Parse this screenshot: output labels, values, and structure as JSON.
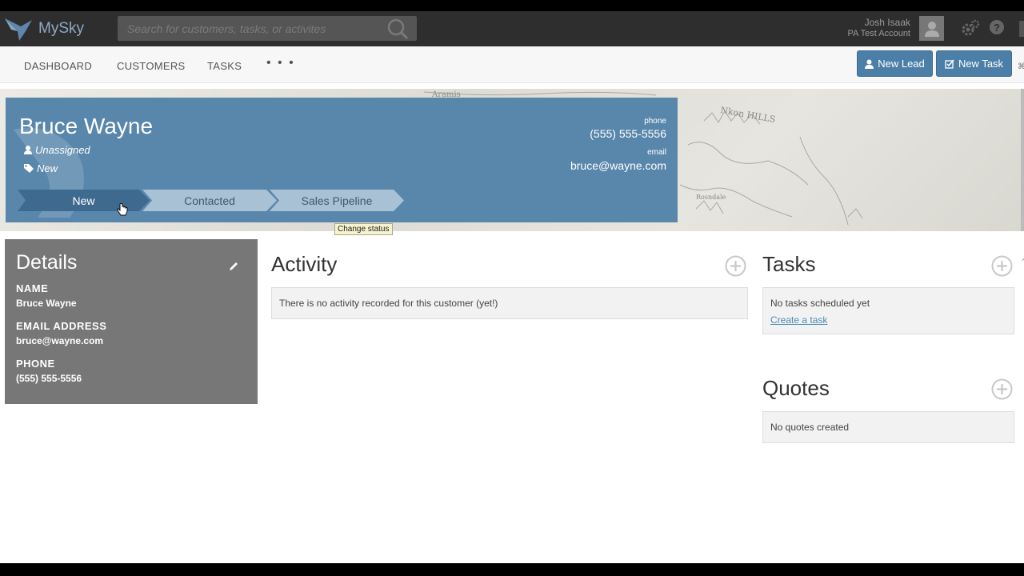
{
  "app": {
    "name": "MySky",
    "search_placeholder": "Search for customers, tasks, or activites",
    "user_name": "Josh Isaak",
    "user_account": "PA Test Account"
  },
  "nav": {
    "items": [
      "DASHBOARD",
      "CUSTOMERS",
      "TASKS"
    ],
    "more": "• • •",
    "new_lead": "New Lead",
    "new_task": "New Task"
  },
  "customer": {
    "name": "Bruce Wayne",
    "assignee": "Unassigned",
    "tag": "New",
    "phone_label": "phone",
    "phone": "(555) 555-5556",
    "email_label": "email",
    "email": "bruce@wayne.com",
    "stages": [
      "New",
      "Contacted",
      "Sales Pipeline"
    ],
    "tooltip": "Change status"
  },
  "details": {
    "title": "Details",
    "name_label": "NAME",
    "name_value": "Bruce Wayne",
    "email_label": "EMAIL ADDRESS",
    "email_value": "bruce@wayne.com",
    "phone_label": "PHONE",
    "phone_value": "(555) 555-5556"
  },
  "activity": {
    "title": "Activity",
    "empty": "There is no activity recorded for this customer (yet!)"
  },
  "tasks": {
    "title": "Tasks",
    "empty": "No tasks scheduled yet",
    "link": "Create a task"
  },
  "quotes": {
    "title": "Quotes",
    "empty": "No quotes created"
  },
  "colors": {
    "topbar": "#2e2e2e",
    "accent": "#4c7fa8",
    "hero": "#5987ac",
    "stage_active": "#3f6a8f",
    "stage_inactive": "#a9c1d4",
    "details_bg": "#777777"
  }
}
